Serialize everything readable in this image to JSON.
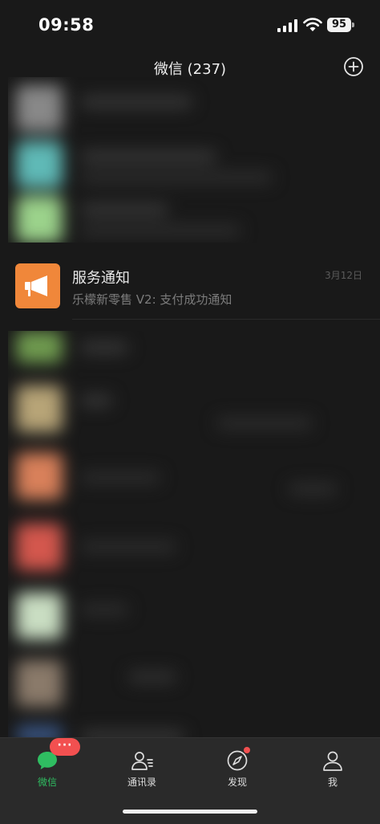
{
  "status_bar": {
    "time": "09:58",
    "battery": "95"
  },
  "header": {
    "title": "微信 (237)"
  },
  "chat_list": {
    "service_notice": {
      "title": "服务通知",
      "preview": "乐檬新零售 V2: 支付成功通知",
      "time": "3月12日"
    }
  },
  "tab_bar": {
    "badge": "···",
    "tabs": [
      {
        "label": "微信",
        "icon": "chat-bubble-icon",
        "active": true
      },
      {
        "label": "通讯录",
        "icon": "contacts-icon"
      },
      {
        "label": "发现",
        "icon": "compass-icon"
      },
      {
        "label": "我",
        "icon": "person-icon"
      }
    ]
  },
  "colors": {
    "accent": "#2fbd61",
    "badge": "#f25050",
    "notice_avatar": "#f0873a"
  }
}
